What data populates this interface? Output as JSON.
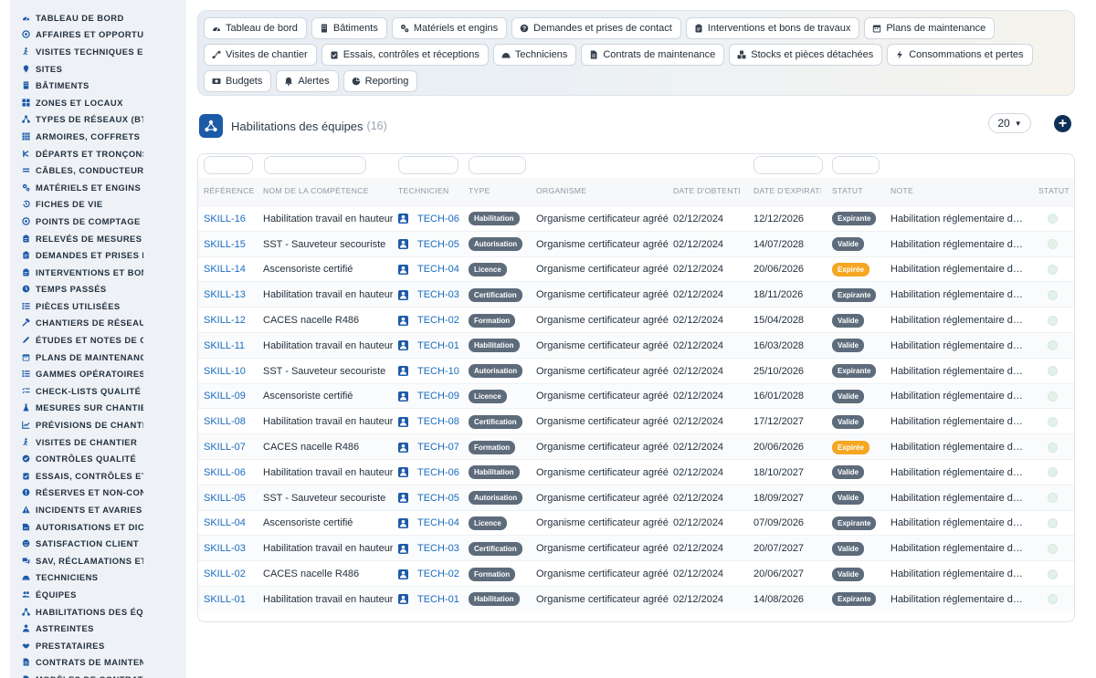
{
  "sidebar": {
    "items": [
      {
        "label": "TABLEAU DE BORD",
        "icon": "gauge-icon"
      },
      {
        "label": "AFFAIRES ET OPPORTUNITÉS",
        "icon": "target-icon"
      },
      {
        "label": "VISITES TECHNIQUES ET RELEVÉS",
        "icon": "walk-icon"
      },
      {
        "label": "SITES",
        "icon": "pin-icon"
      },
      {
        "label": "BÂTIMENTS",
        "icon": "building-icon"
      },
      {
        "label": "ZONES ET LOCAUX",
        "icon": "grid-icon"
      },
      {
        "label": "TYPES DE RÉSEAUX (BT / HTA)",
        "icon": "network-icon"
      },
      {
        "label": "ARMOIRES, COFFRETS ET TABLEAUX",
        "icon": "cabinet-icon"
      },
      {
        "label": "DÉPARTS ET TRONÇONS",
        "icon": "branch-icon"
      },
      {
        "label": "CÂBLES, CONDUCTEURS",
        "icon": "cable-icon"
      },
      {
        "label": "MATÉRIELS ET ENGINS",
        "icon": "gears-icon"
      },
      {
        "label": "FICHES DE VIE",
        "icon": "history-icon"
      },
      {
        "label": "POINTS DE COMPTAGE ET MESURE",
        "icon": "target-icon"
      },
      {
        "label": "RELEVÉS DE MESURES",
        "icon": "clipboard-icon"
      },
      {
        "label": "DEMANDES ET PRISES DE CONTACT",
        "icon": "clipboard-icon"
      },
      {
        "label": "INTERVENTIONS ET BONS DE TRAVAUX",
        "icon": "clipboard-icon"
      },
      {
        "label": "TEMPS PASSÉS",
        "icon": "clock-icon"
      },
      {
        "label": "PIÈCES UTILISÉES",
        "icon": "list-icon"
      },
      {
        "label": "CHANTIERS DE RÉSEAUX",
        "icon": "hammer-icon"
      },
      {
        "label": "ÉTUDES ET NOTES DE CALCUL",
        "icon": "pencil-icon"
      },
      {
        "label": "PLANS DE MAINTENANCE",
        "icon": "calendar-icon"
      },
      {
        "label": "GAMMES OPÉRATOIRES",
        "icon": "list-icon"
      },
      {
        "label": "CHECK-LISTS QUALITÉ",
        "icon": "checklist-icon"
      },
      {
        "label": "MESURES SUR CHANTIER",
        "icon": "flask-icon"
      },
      {
        "label": "PRÉVISIONS DE CHANTIER",
        "icon": "chart-icon"
      },
      {
        "label": "VISITES DE CHANTIER",
        "icon": "walk-icon"
      },
      {
        "label": "CONTRÔLES QUALITÉ",
        "icon": "check-circle-icon"
      },
      {
        "label": "ESSAIS, CONTRÔLES ET RÉCEPTIONS",
        "icon": "clipboard-check-icon"
      },
      {
        "label": "RÉSERVES ET NON-CONFORMITÉS",
        "icon": "exclamation-icon"
      },
      {
        "label": "INCIDENTS ET AVARIES",
        "icon": "warning-icon"
      },
      {
        "label": "AUTORISATIONS ET DICT",
        "icon": "signature-icon"
      },
      {
        "label": "SATISFACTION CLIENT",
        "icon": "smile-icon"
      },
      {
        "label": "SAV, RÉCLAMATIONS ET GARANTIES",
        "icon": "comments-icon"
      },
      {
        "label": "TECHNICIENS",
        "icon": "helmet-icon"
      },
      {
        "label": "ÉQUIPES",
        "icon": "users-icon"
      },
      {
        "label": "HABILITATIONS DES ÉQUIPES",
        "icon": "network-icon"
      },
      {
        "label": "ASTREINTES",
        "icon": "person-icon"
      },
      {
        "label": "PRESTATAIRES",
        "icon": "handshake-icon"
      },
      {
        "label": "CONTRATS DE MAINTENANCE",
        "icon": "file-icon"
      },
      {
        "label": "MODÈLES DE CONTRATS",
        "icon": "file-icon"
      }
    ]
  },
  "topnav": {
    "items": [
      {
        "label": "Tableau de bord",
        "icon": "gauge-icon"
      },
      {
        "label": "Bâtiments",
        "icon": "building-icon"
      },
      {
        "label": "Matériels et engins",
        "icon": "gears-icon"
      },
      {
        "label": "Demandes et prises de contact",
        "icon": "question-icon"
      },
      {
        "label": "Interventions et bons de travaux",
        "icon": "clipboard-icon"
      },
      {
        "label": "Plans de maintenance",
        "icon": "calendar-icon"
      },
      {
        "label": "Visites de chantier",
        "icon": "route-icon"
      },
      {
        "label": "Essais, contrôles et réceptions",
        "icon": "clipboard-check-icon"
      },
      {
        "label": "Techniciens",
        "icon": "helmet-icon"
      },
      {
        "label": "Contrats de maintenance",
        "icon": "file-icon"
      },
      {
        "label": "Stocks et pièces détachées",
        "icon": "boxes-icon"
      },
      {
        "label": "Consommations et pertes",
        "icon": "bolt-icon"
      },
      {
        "label": "Budgets",
        "icon": "money-icon"
      },
      {
        "label": "Alertes",
        "icon": "bell-icon"
      },
      {
        "label": "Reporting",
        "icon": "pie-icon"
      }
    ]
  },
  "header": {
    "title": "Habilitations des équipes",
    "count": "(16)",
    "icon": "network-icon",
    "page_size": "20"
  },
  "table": {
    "columns": [
      "RÉFÉRENCE",
      "NOM DE LA COMPÉTENCE",
      "TECHNICIEN",
      "TYPE",
      "ORGANISME",
      "DATE D'OBTENTION",
      "DATE D'EXPIRATION",
      "STATUT",
      "NOTE",
      "STATUT"
    ],
    "status_colors": {
      "Expirante": "#5d6b7b",
      "Valide": "#5d6b7b",
      "Expirée": "#f5a623"
    },
    "rows": [
      {
        "ref": "SKILL-16",
        "name": "Habilitation travail en hauteur",
        "tech": "TECH-06",
        "type": "Habilitation",
        "org": "Organisme certificateur agréé",
        "obt": "02/12/2024",
        "exp": "12/12/2026",
        "status": "Expirante",
        "note": "Habilitation réglementaire du technicien"
      },
      {
        "ref": "SKILL-15",
        "name": "SST - Sauveteur secouriste",
        "tech": "TECH-05",
        "type": "Autorisation",
        "org": "Organisme certificateur agréé",
        "obt": "02/12/2024",
        "exp": "14/07/2028",
        "status": "Valide",
        "note": "Habilitation réglementaire du technicien"
      },
      {
        "ref": "SKILL-14",
        "name": "Ascensoriste certifié",
        "tech": "TECH-04",
        "type": "Licence",
        "org": "Organisme certificateur agréé",
        "obt": "02/12/2024",
        "exp": "20/06/2026",
        "status": "Expirée",
        "note": "Habilitation réglementaire du technicien"
      },
      {
        "ref": "SKILL-13",
        "name": "Habilitation travail en hauteur",
        "tech": "TECH-03",
        "type": "Certification",
        "org": "Organisme certificateur agréé",
        "obt": "02/12/2024",
        "exp": "18/11/2026",
        "status": "Expirante",
        "note": "Habilitation réglementaire du technicien"
      },
      {
        "ref": "SKILL-12",
        "name": "CACES nacelle R486",
        "tech": "TECH-02",
        "type": "Formation",
        "org": "Organisme certificateur agréé",
        "obt": "02/12/2024",
        "exp": "15/04/2028",
        "status": "Valide",
        "note": "Habilitation réglementaire du technicien"
      },
      {
        "ref": "SKILL-11",
        "name": "Habilitation travail en hauteur",
        "tech": "TECH-01",
        "type": "Habilitation",
        "org": "Organisme certificateur agréé",
        "obt": "02/12/2024",
        "exp": "16/03/2028",
        "status": "Valide",
        "note": "Habilitation réglementaire du technicien"
      },
      {
        "ref": "SKILL-10",
        "name": "SST - Sauveteur secouriste",
        "tech": "TECH-10",
        "type": "Autorisation",
        "org": "Organisme certificateur agréé",
        "obt": "02/12/2024",
        "exp": "25/10/2026",
        "status": "Expirante",
        "note": "Habilitation réglementaire du technicien"
      },
      {
        "ref": "SKILL-09",
        "name": "Ascensoriste certifié",
        "tech": "TECH-09",
        "type": "Licence",
        "org": "Organisme certificateur agréé",
        "obt": "02/12/2024",
        "exp": "16/01/2028",
        "status": "Valide",
        "note": "Habilitation réglementaire du technicien"
      },
      {
        "ref": "SKILL-08",
        "name": "Habilitation travail en hauteur",
        "tech": "TECH-08",
        "type": "Certification",
        "org": "Organisme certificateur agréé",
        "obt": "02/12/2024",
        "exp": "17/12/2027",
        "status": "Valide",
        "note": "Habilitation réglementaire du technicien"
      },
      {
        "ref": "SKILL-07",
        "name": "CACES nacelle R486",
        "tech": "TECH-07",
        "type": "Formation",
        "org": "Organisme certificateur agréé",
        "obt": "02/12/2024",
        "exp": "20/06/2026",
        "status": "Expirée",
        "note": "Habilitation réglementaire du technicien"
      },
      {
        "ref": "SKILL-06",
        "name": "Habilitation travail en hauteur",
        "tech": "TECH-06",
        "type": "Habilitation",
        "org": "Organisme certificateur agréé",
        "obt": "02/12/2024",
        "exp": "18/10/2027",
        "status": "Valide",
        "note": "Habilitation réglementaire du technicien"
      },
      {
        "ref": "SKILL-05",
        "name": "SST - Sauveteur secouriste",
        "tech": "TECH-05",
        "type": "Autorisation",
        "org": "Organisme certificateur agréé",
        "obt": "02/12/2024",
        "exp": "18/09/2027",
        "status": "Valide",
        "note": "Habilitation réglementaire du technicien"
      },
      {
        "ref": "SKILL-04",
        "name": "Ascensoriste certifié",
        "tech": "TECH-04",
        "type": "Licence",
        "org": "Organisme certificateur agréé",
        "obt": "02/12/2024",
        "exp": "07/09/2026",
        "status": "Expirante",
        "note": "Habilitation réglementaire du technicien"
      },
      {
        "ref": "SKILL-03",
        "name": "Habilitation travail en hauteur",
        "tech": "TECH-03",
        "type": "Certification",
        "org": "Organisme certificateur agréé",
        "obt": "02/12/2024",
        "exp": "20/07/2027",
        "status": "Valide",
        "note": "Habilitation réglementaire du technicien"
      },
      {
        "ref": "SKILL-02",
        "name": "CACES nacelle R486",
        "tech": "TECH-02",
        "type": "Formation",
        "org": "Organisme certificateur agréé",
        "obt": "02/12/2024",
        "exp": "20/06/2027",
        "status": "Valide",
        "note": "Habilitation réglementaire du technicien"
      },
      {
        "ref": "SKILL-01",
        "name": "Habilitation travail en hauteur",
        "tech": "TECH-01",
        "type": "Habilitation",
        "org": "Organisme certificateur agréé",
        "obt": "02/12/2024",
        "exp": "14/08/2026",
        "status": "Expirante",
        "note": "Habilitation réglementaire du technicien"
      }
    ]
  }
}
